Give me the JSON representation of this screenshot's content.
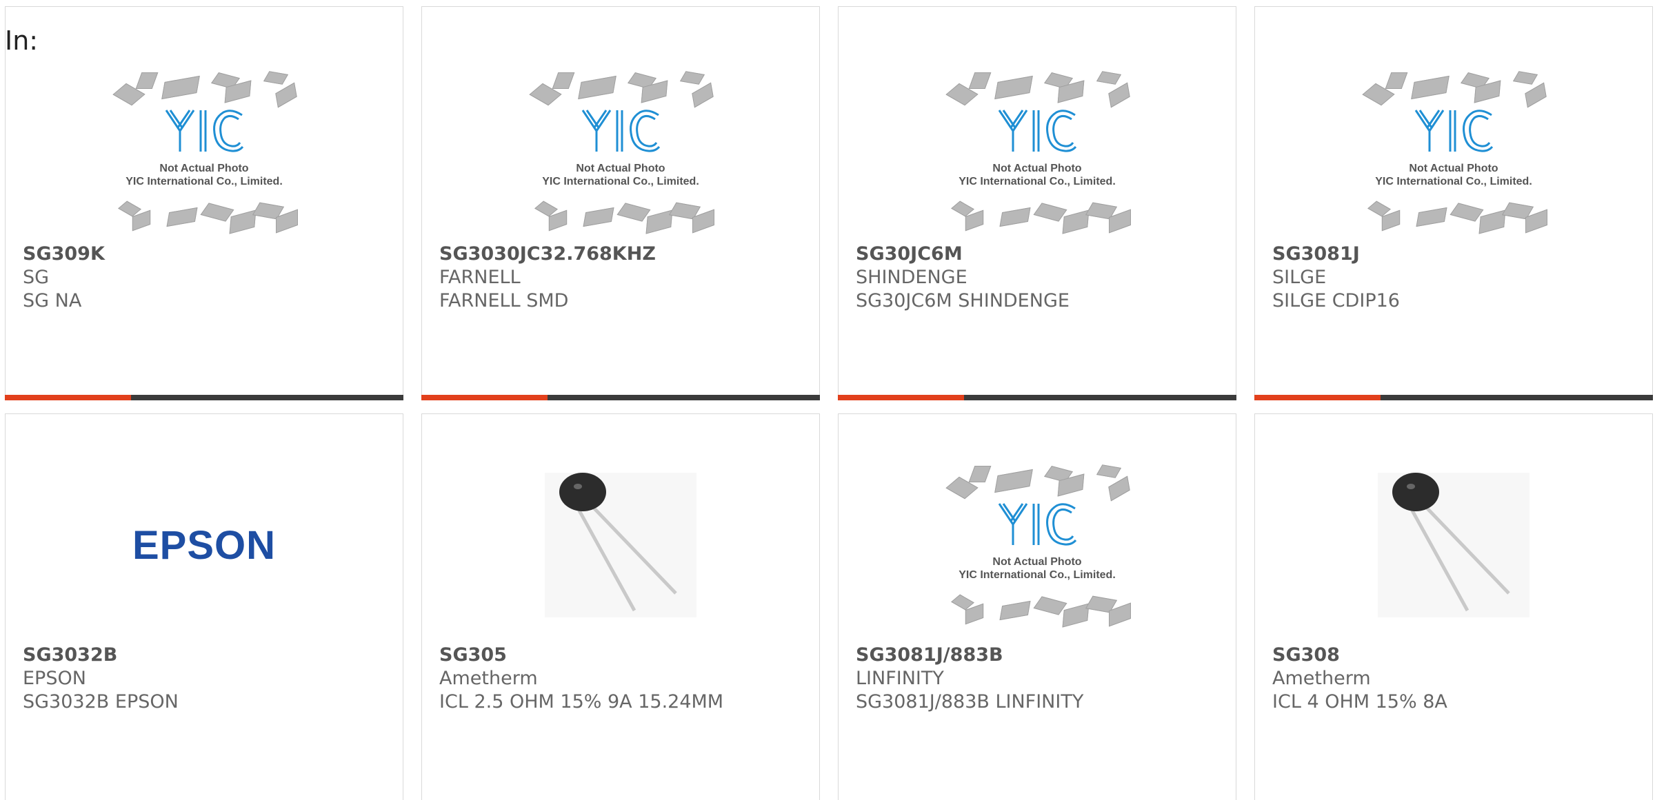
{
  "header": {
    "in_label": "In:"
  },
  "placeholder": {
    "line1": "Not Actual Photo",
    "line2": "YIC International Co., Limited."
  },
  "epson_logo_text": "EPSON",
  "products": [
    {
      "part": "SG309K",
      "maker": "SG",
      "desc": "SG NA",
      "image": "yic-placeholder"
    },
    {
      "part": "SG3030JC32.768KHZ",
      "maker": "FARNELL",
      "desc": "FARNELL SMD",
      "image": "yic-placeholder"
    },
    {
      "part": "SG30JC6M",
      "maker": "SHINDENGE",
      "desc": "SG30JC6M SHINDENGE",
      "image": "yic-placeholder"
    },
    {
      "part": "SG3081J",
      "maker": "SILGE",
      "desc": "SILGE CDIP16",
      "image": "yic-placeholder"
    },
    {
      "part": "SG3032B",
      "maker": "EPSON",
      "desc": "SG3032B EPSON",
      "image": "epson-logo"
    },
    {
      "part": "SG305",
      "maker": "Ametherm",
      "desc": "ICL 2.5 OHM 15% 9A 15.24MM",
      "image": "thermistor-photo"
    },
    {
      "part": "SG3081J/883B",
      "maker": "LINFINITY",
      "desc": "SG3081J/883B LINFINITY",
      "image": "yic-placeholder"
    },
    {
      "part": "SG308",
      "maker": "Ametherm",
      "desc": "ICL 4 OHM 15% 8A",
      "image": "thermistor-photo"
    }
  ],
  "colors": {
    "accent": "#e2401c",
    "bar": "#3b3b3b",
    "text": "#666666"
  }
}
